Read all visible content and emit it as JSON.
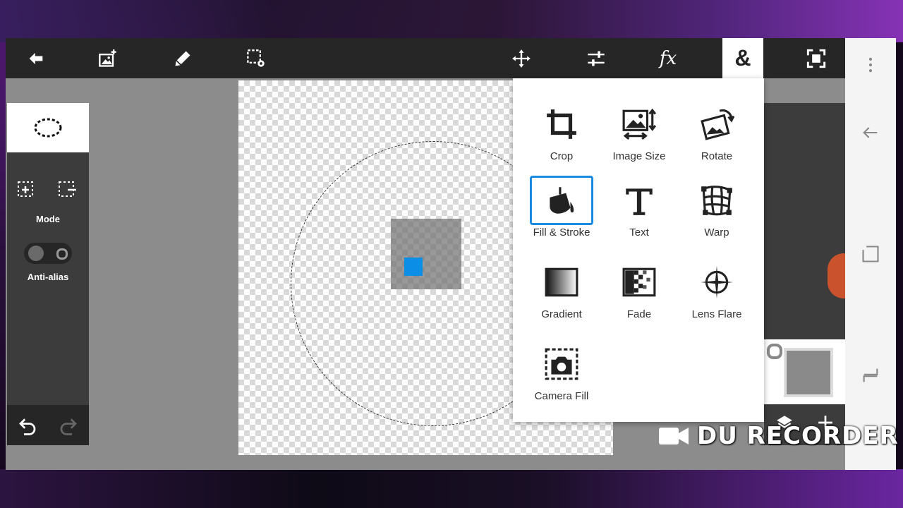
{
  "toolbar": {
    "icons": [
      "back-arrow-icon",
      "add-image-icon",
      "brush-icon",
      "selection-settings-icon",
      "move-icon",
      "adjustments-icon",
      "fx-icon",
      "ampersand-icon",
      "fullscreen-icon"
    ],
    "fx_label": "fx",
    "active_tab_label": "&"
  },
  "left_panel": {
    "mode_label": "Mode",
    "antialias_label": "Anti-alias"
  },
  "menu": {
    "items": [
      {
        "label": "Crop",
        "icon": "crop-icon"
      },
      {
        "label": "Image Size",
        "icon": "image-size-icon"
      },
      {
        "label": "Rotate",
        "icon": "rotate-icon"
      },
      {
        "label": "Fill & Stroke",
        "icon": "fill-stroke-icon",
        "selected": true
      },
      {
        "label": "Text",
        "icon": "text-icon"
      },
      {
        "label": "Warp",
        "icon": "warp-icon"
      },
      {
        "label": "Gradient",
        "icon": "gradient-icon"
      },
      {
        "label": "Fade",
        "icon": "fade-icon"
      },
      {
        "label": "Lens Flare",
        "icon": "lens-flare-icon"
      },
      {
        "label": "Camera Fill",
        "icon": "camera-fill-icon"
      }
    ]
  },
  "watermark": {
    "text": "DU RECORDER"
  },
  "colors": {
    "accent": "#1a8be0",
    "topbar": "#262626",
    "panel": "#3c3c3c",
    "layer_blue": "#0b8ee6"
  }
}
